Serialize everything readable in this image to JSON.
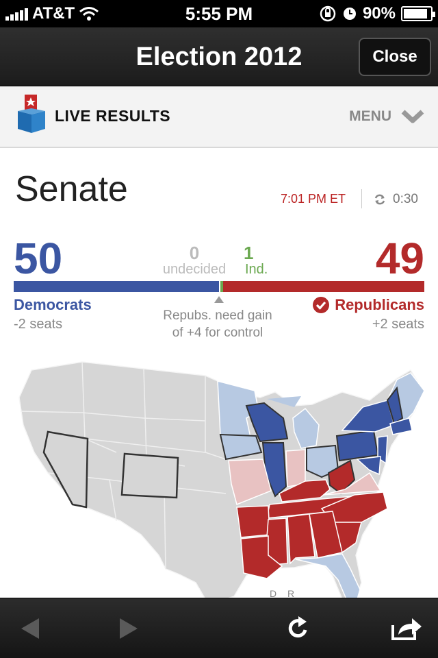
{
  "status_bar": {
    "carrier": "AT&T",
    "time": "5:55 PM",
    "battery": "90%",
    "battery_level": 0.9
  },
  "nav": {
    "title": "Election 2012",
    "close_label": "Close"
  },
  "header": {
    "live_label": "LIVE RESULTS",
    "menu_label": "MENU"
  },
  "senate": {
    "title": "Senate",
    "timestamp": "7:01 PM ET",
    "refresh_countdown": "0:30",
    "democrats": {
      "count": "50",
      "label": "Democrats",
      "change": "-2 seats",
      "color": "#3b56a2"
    },
    "undecided": {
      "count": "0",
      "label": "undecided"
    },
    "independent": {
      "count": "1",
      "label": "Ind.",
      "color": "#6aa84f"
    },
    "republicans": {
      "count": "49",
      "label": "Republicans",
      "change": "+2 seats",
      "color": "#b32a2a"
    },
    "control_note_line1": "Repubs. need gain",
    "control_note_line2": "of +4 for control",
    "seat_split": {
      "dem": 50,
      "ind": 1,
      "rep": 49
    }
  },
  "map": {
    "legend_text": "D  R",
    "colors": {
      "no_race": "#d6d6d6",
      "dem_hold": "#3b56a2",
      "dem_lean": "#b7c9e2",
      "rep_hold": "#b32a2a",
      "rep_lean": "#e8c2c2"
    }
  },
  "toolbar": {
    "back_icon": "back-arrow-icon",
    "forward_icon": "forward-arrow-icon",
    "reload_icon": "reload-icon",
    "share_icon": "share-icon"
  }
}
